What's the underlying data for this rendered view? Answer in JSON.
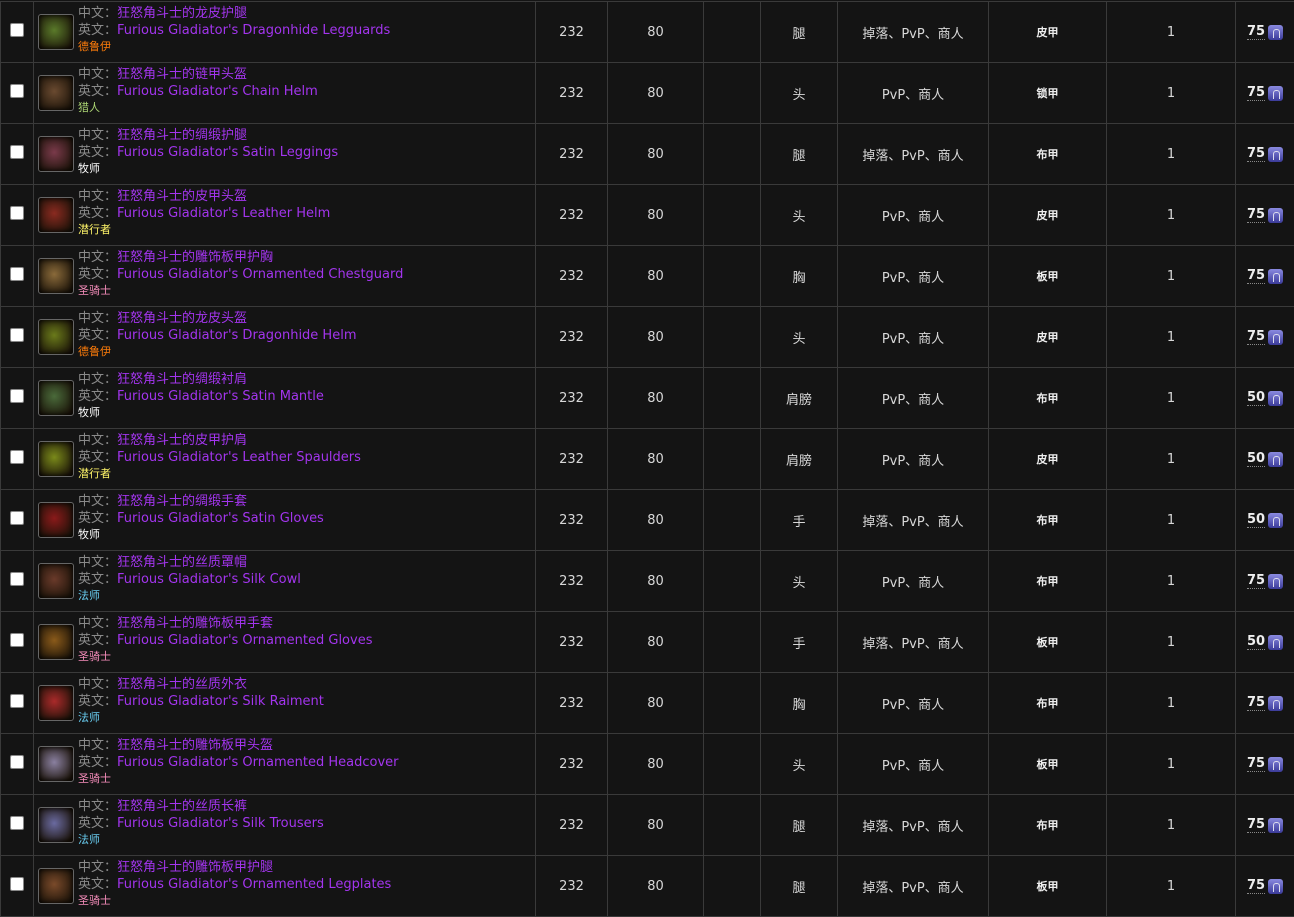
{
  "labels": {
    "zh": "中文：",
    "en": "英文："
  },
  "class_colors": {
    "德鲁伊": "#ff7d0a",
    "猎人": "#abd473",
    "牧师": "#ffffff",
    "潜行者": "#fff569",
    "圣骑士": "#f58cba",
    "法师": "#69ccf0"
  },
  "currency_icon": "arena-point-icon",
  "rows": [
    {
      "zh": "狂怒角斗士的龙皮护腿",
      "en": "Furious Gladiator's Dragonhide Legguards",
      "cls": "德鲁伊",
      "ilvl": "232",
      "req": "80",
      "extra": "",
      "slot": "腿",
      "source": "掉落、PvP、商人",
      "armor": "皮甲",
      "count": "1",
      "price": "75",
      "icon_color": "#5a7a2a"
    },
    {
      "zh": "狂怒角斗士的链甲头盔",
      "en": "Furious Gladiator's Chain Helm",
      "cls": "猎人",
      "ilvl": "232",
      "req": "80",
      "extra": "",
      "slot": "头",
      "source": "PvP、商人",
      "armor": "锁甲",
      "count": "1",
      "price": "75",
      "icon_color": "#6a4a30"
    },
    {
      "zh": "狂怒角斗士的绸缎护腿",
      "en": "Furious Gladiator's Satin Leggings",
      "cls": "牧师",
      "ilvl": "232",
      "req": "80",
      "extra": "",
      "slot": "腿",
      "source": "掉落、PvP、商人",
      "armor": "布甲",
      "count": "1",
      "price": "75",
      "icon_color": "#7a3a4a"
    },
    {
      "zh": "狂怒角斗士的皮甲头盔",
      "en": "Furious Gladiator's Leather Helm",
      "cls": "潜行者",
      "ilvl": "232",
      "req": "80",
      "extra": "",
      "slot": "头",
      "source": "PvP、商人",
      "armor": "皮甲",
      "count": "1",
      "price": "75",
      "icon_color": "#8a2a20"
    },
    {
      "zh": "狂怒角斗士的雕饰板甲护胸",
      "en": "Furious Gladiator's Ornamented Chestguard",
      "cls": "圣骑士",
      "ilvl": "232",
      "req": "80",
      "extra": "",
      "slot": "胸",
      "source": "PvP、商人",
      "armor": "板甲",
      "count": "1",
      "price": "75",
      "icon_color": "#8a6a3a"
    },
    {
      "zh": "狂怒角斗士的龙皮头盔",
      "en": "Furious Gladiator's Dragonhide Helm",
      "cls": "德鲁伊",
      "ilvl": "232",
      "req": "80",
      "extra": "",
      "slot": "头",
      "source": "PvP、商人",
      "armor": "皮甲",
      "count": "1",
      "price": "75",
      "icon_color": "#6a7a1a"
    },
    {
      "zh": "狂怒角斗士的绸缎衬肩",
      "en": "Furious Gladiator's Satin Mantle",
      "cls": "牧师",
      "ilvl": "232",
      "req": "80",
      "extra": "",
      "slot": "肩膀",
      "source": "PvP、商人",
      "armor": "布甲",
      "count": "1",
      "price": "50",
      "icon_color": "#4a6a3a"
    },
    {
      "zh": "狂怒角斗士的皮甲护肩",
      "en": "Furious Gladiator's Leather Spaulders",
      "cls": "潜行者",
      "ilvl": "232",
      "req": "80",
      "extra": "",
      "slot": "肩膀",
      "source": "PvP、商人",
      "armor": "皮甲",
      "count": "1",
      "price": "50",
      "icon_color": "#7a8a1a"
    },
    {
      "zh": "狂怒角斗士的绸缎手套",
      "en": "Furious Gladiator's Satin Gloves",
      "cls": "牧师",
      "ilvl": "232",
      "req": "80",
      "extra": "",
      "slot": "手",
      "source": "掉落、PvP、商人",
      "armor": "布甲",
      "count": "1",
      "price": "50",
      "icon_color": "#8a1a1a"
    },
    {
      "zh": "狂怒角斗士的丝质罩帽",
      "en": "Furious Gladiator's Silk Cowl",
      "cls": "法师",
      "ilvl": "232",
      "req": "80",
      "extra": "",
      "slot": "头",
      "source": "PvP、商人",
      "armor": "布甲",
      "count": "1",
      "price": "75",
      "icon_color": "#6a3a2a"
    },
    {
      "zh": "狂怒角斗士的雕饰板甲手套",
      "en": "Furious Gladiator's Ornamented Gloves",
      "cls": "圣骑士",
      "ilvl": "232",
      "req": "80",
      "extra": "",
      "slot": "手",
      "source": "掉落、PvP、商人",
      "armor": "板甲",
      "count": "1",
      "price": "50",
      "icon_color": "#8a5a1a"
    },
    {
      "zh": "狂怒角斗士的丝质外衣",
      "en": "Furious Gladiator's Silk Raiment",
      "cls": "法师",
      "ilvl": "232",
      "req": "80",
      "extra": "",
      "slot": "胸",
      "source": "PvP、商人",
      "armor": "布甲",
      "count": "1",
      "price": "75",
      "icon_color": "#aa2a2a"
    },
    {
      "zh": "狂怒角斗士的雕饰板甲头盔",
      "en": "Furious Gladiator's Ornamented Headcover",
      "cls": "圣骑士",
      "ilvl": "232",
      "req": "80",
      "extra": "",
      "slot": "头",
      "source": "PvP、商人",
      "armor": "板甲",
      "count": "1",
      "price": "75",
      "icon_color": "#8a80a0"
    },
    {
      "zh": "狂怒角斗士的丝质长裤",
      "en": "Furious Gladiator's Silk Trousers",
      "cls": "法师",
      "ilvl": "232",
      "req": "80",
      "extra": "",
      "slot": "腿",
      "source": "掉落、PvP、商人",
      "armor": "布甲",
      "count": "1",
      "price": "75",
      "icon_color": "#6a6aa0"
    },
    {
      "zh": "狂怒角斗士的雕饰板甲护腿",
      "en": "Furious Gladiator's Ornamented Legplates",
      "cls": "圣骑士",
      "ilvl": "232",
      "req": "80",
      "extra": "",
      "slot": "腿",
      "source": "掉落、PvP、商人",
      "armor": "板甲",
      "count": "1",
      "price": "75",
      "icon_color": "#7a4a2a"
    }
  ]
}
